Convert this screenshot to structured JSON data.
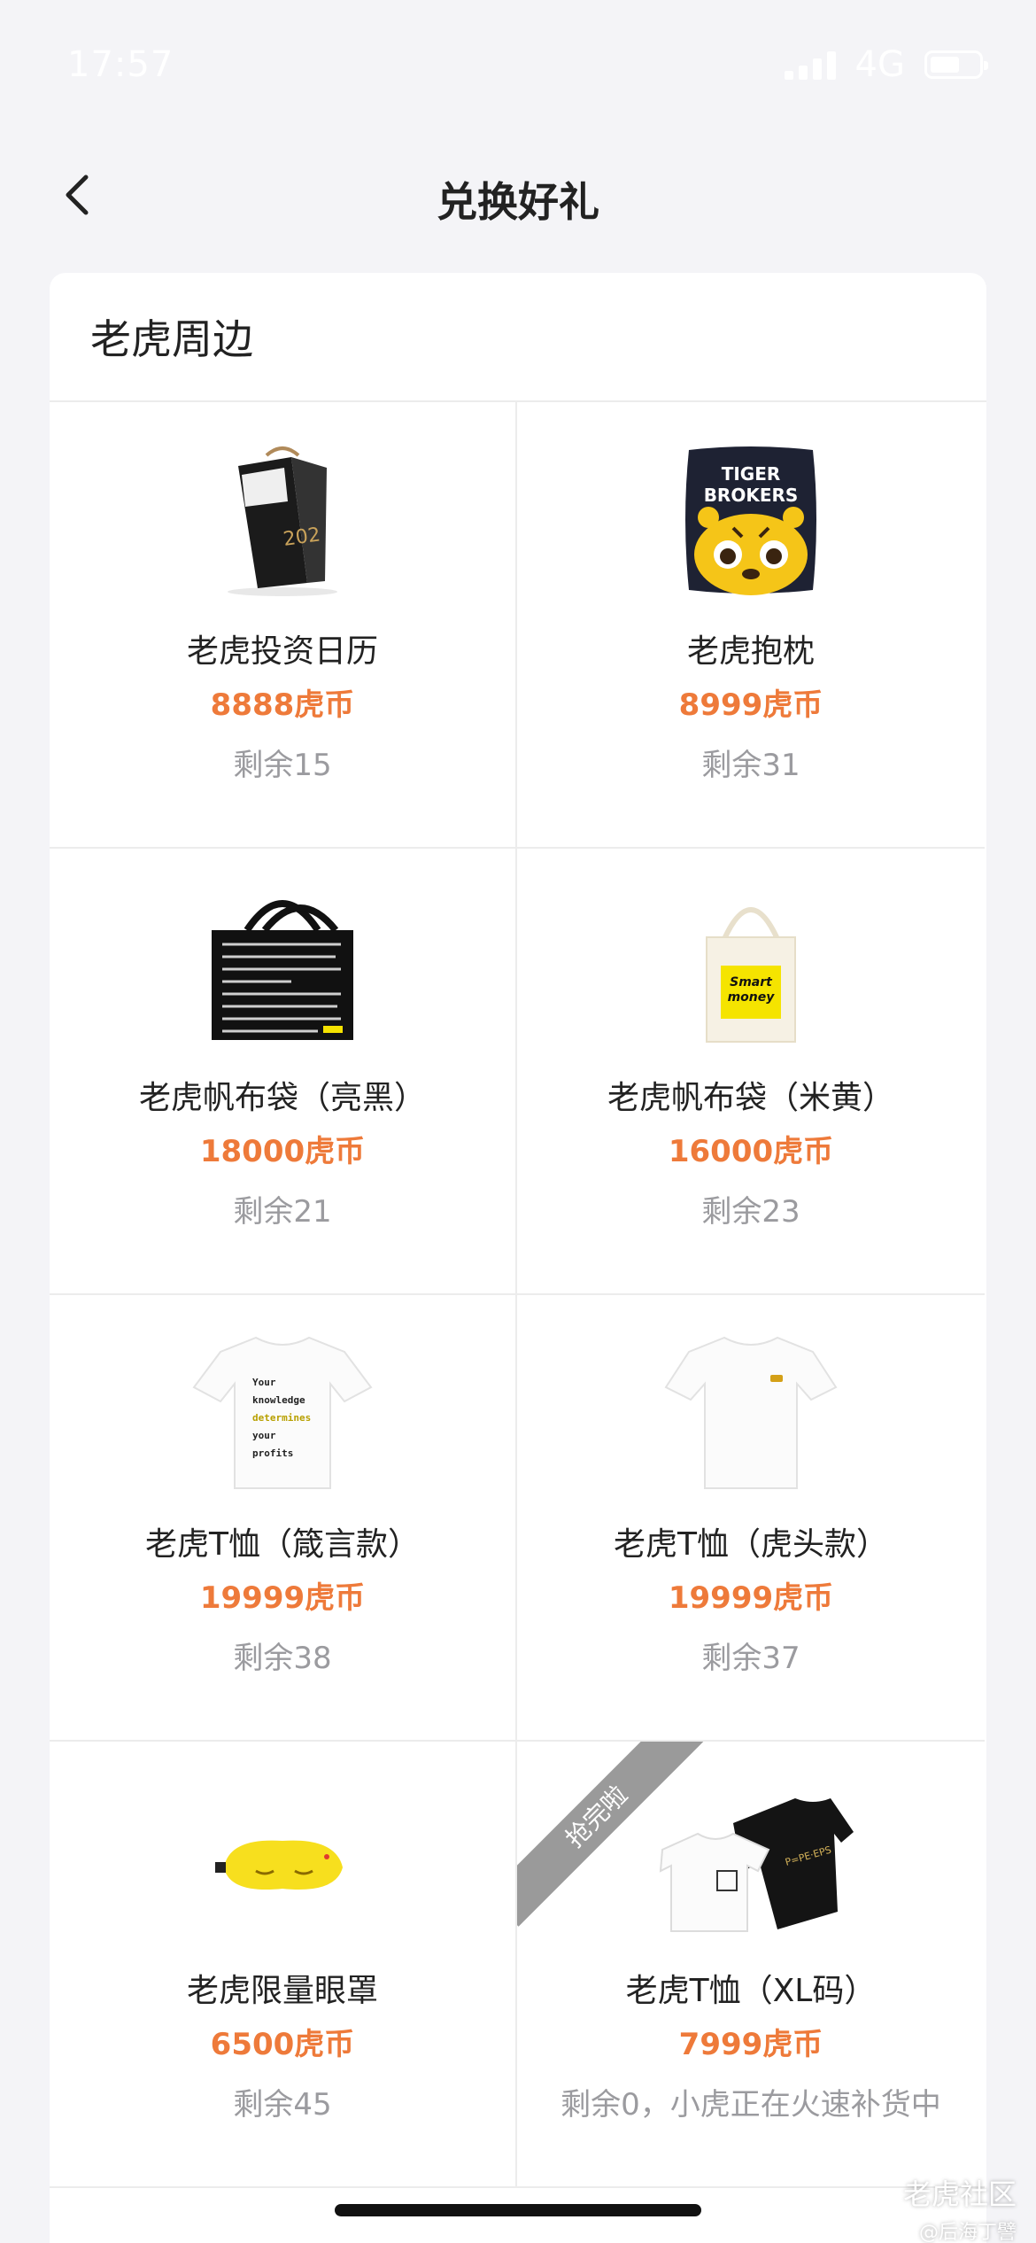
{
  "status_bar": {
    "time": "17:57",
    "network": "4G",
    "battery_level": 0.62
  },
  "nav": {
    "title": "兑换好礼"
  },
  "section": {
    "title": "老虎周边"
  },
  "products": [
    {
      "name": "老虎投资日历",
      "price": "8888虎币",
      "stock": "剩余15",
      "icon": "desk-calendar-icon"
    },
    {
      "name": "老虎抱枕",
      "price": "8999虎币",
      "stock": "剩余31",
      "icon": "tiger-pillow-icon",
      "image_text": [
        "TIGER",
        "BROKERS"
      ]
    },
    {
      "name": "老虎帆布袋（亮黑）",
      "price": "18000虎币",
      "stock": "剩余21",
      "icon": "black-tote-bag-icon"
    },
    {
      "name": "老虎帆布袋（米黄）",
      "price": "16000虎币",
      "stock": "剩余23",
      "icon": "beige-tote-bag-icon",
      "image_text": [
        "Smart",
        "money"
      ]
    },
    {
      "name": "老虎T恤（箴言款）",
      "price": "19999虎币",
      "stock": "剩余38",
      "icon": "motto-tshirt-icon",
      "image_text": [
        "Your",
        "knowledge",
        "determines",
        "your",
        "profits"
      ]
    },
    {
      "name": "老虎T恤（虎头款）",
      "price": "19999虎币",
      "stock": "剩余37",
      "icon": "tiger-head-tshirt-icon"
    },
    {
      "name": "老虎限量眼罩",
      "price": "6500虎币",
      "stock": "剩余45",
      "icon": "eye-mask-icon"
    },
    {
      "name": "老虎T恤（XL码）",
      "price": "7999虎币",
      "stock": "剩余0，小虎正在火速补货中",
      "icon": "tshirt-pair-icon",
      "badge": "抢完啦",
      "image_text": [
        "P=PE·EPS"
      ]
    }
  ],
  "watermark": {
    "main": "老虎社区",
    "sub": "@后海丁譬"
  },
  "colors": {
    "price": "#ee7a3a",
    "stock": "#9b9b9f",
    "background": "#f4f4f7",
    "badge": "#9a9a9a"
  }
}
